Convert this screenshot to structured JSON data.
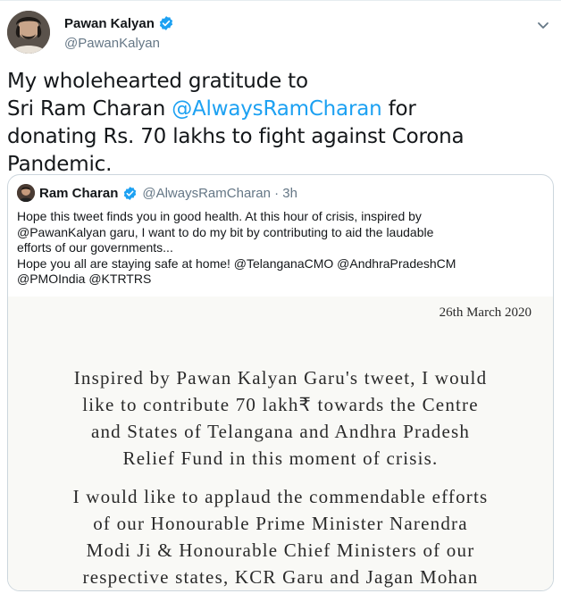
{
  "tweet": {
    "display_name": "Pawan Kalyan",
    "handle": "@PawanKalyan",
    "text_before": "My wholehearted gratitude to\nSri Ram Charan ",
    "mention": "@AlwaysRamCharan",
    "text_after": " for\ndonating Rs. 70 lakhs to fight against Corona Pandemic.",
    "avatar_icon": "profile-photo",
    "verified_icon": "verified-badge-icon",
    "more_icon": "chevron-down-icon",
    "accent_color": "#1da1f2"
  },
  "quoted_tweet": {
    "display_name": "Ram Charan",
    "handle": "@AlwaysRamCharan · 3h",
    "text": "Hope this tweet finds you in good health. At this hour of crisis, inspired by\n@PawanKalyan garu, I want to do my bit by contributing to aid the laudable\nefforts of our governments...\nHope you all are staying safe at home! @TelanganaCMO @AndhraPradeshCM\n@PMOIndia @KTRTRS",
    "image": {
      "date": "26th March 2020",
      "paragraph1": "Inspired by Pawan Kalyan Garu's tweet, I would\nlike to contribute 70 lakh₹  towards the Centre\nand States of Telangana and Andhra Pradesh\nRelief Fund in this moment of crisis.",
      "paragraph2": "I would like to applaud the commendable efforts\nof our Honourable Prime Minister Narendra\nModi Ji & Honourable Chief Ministers of our\nrespective states, KCR Garu and Jagan Mohan"
    }
  }
}
